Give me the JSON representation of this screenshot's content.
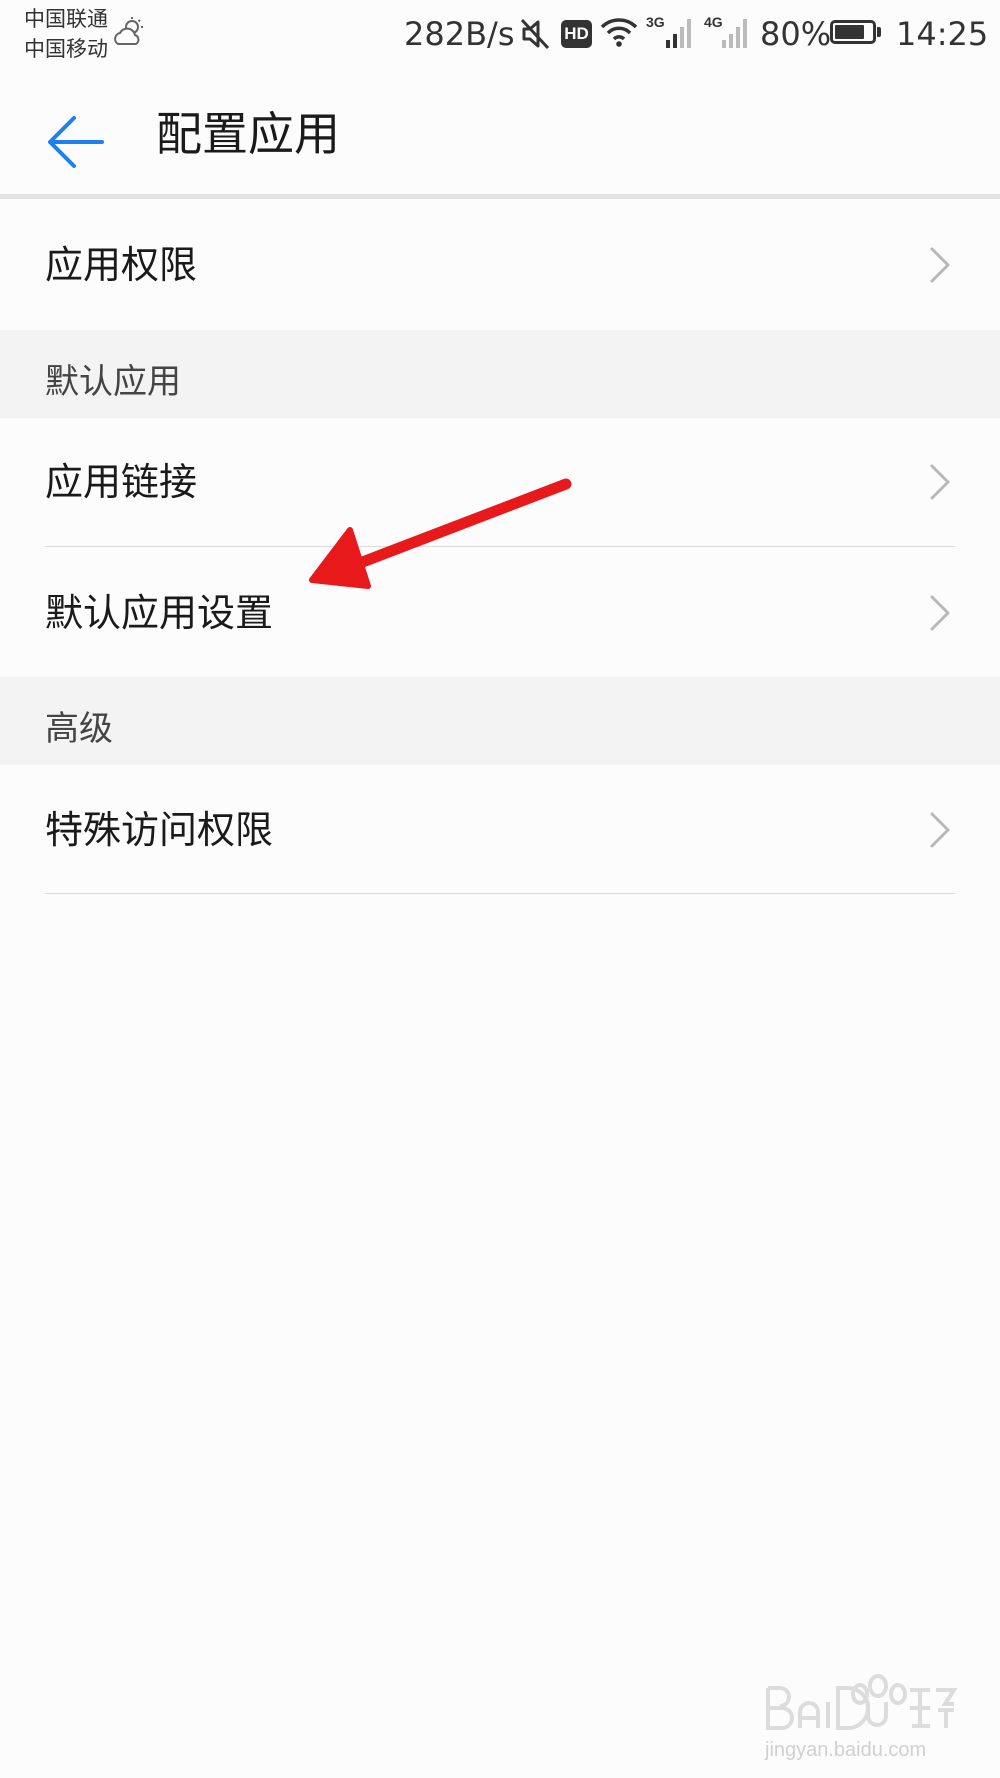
{
  "status_bar": {
    "carrier_1": "中国联通",
    "carrier_2": "中国移动",
    "net_speed": "282B/s",
    "hd_badge": "HD",
    "net_3g": "3G",
    "net_4g": "4G",
    "battery_percent": "80%",
    "battery_level": 0.8,
    "time": "14:25"
  },
  "app_bar": {
    "title": "配置应用"
  },
  "list": {
    "app_permissions": "应用权限",
    "section_default_apps": "默认应用",
    "app_links": "应用链接",
    "default_app_settings": "默认应用设置",
    "section_advanced": "高级",
    "special_access": "特殊访问权限"
  },
  "watermark": {
    "text": "jingyan.baidu.com"
  },
  "colors": {
    "accent": "#1e7ff0",
    "annotation": "#e8191b"
  }
}
